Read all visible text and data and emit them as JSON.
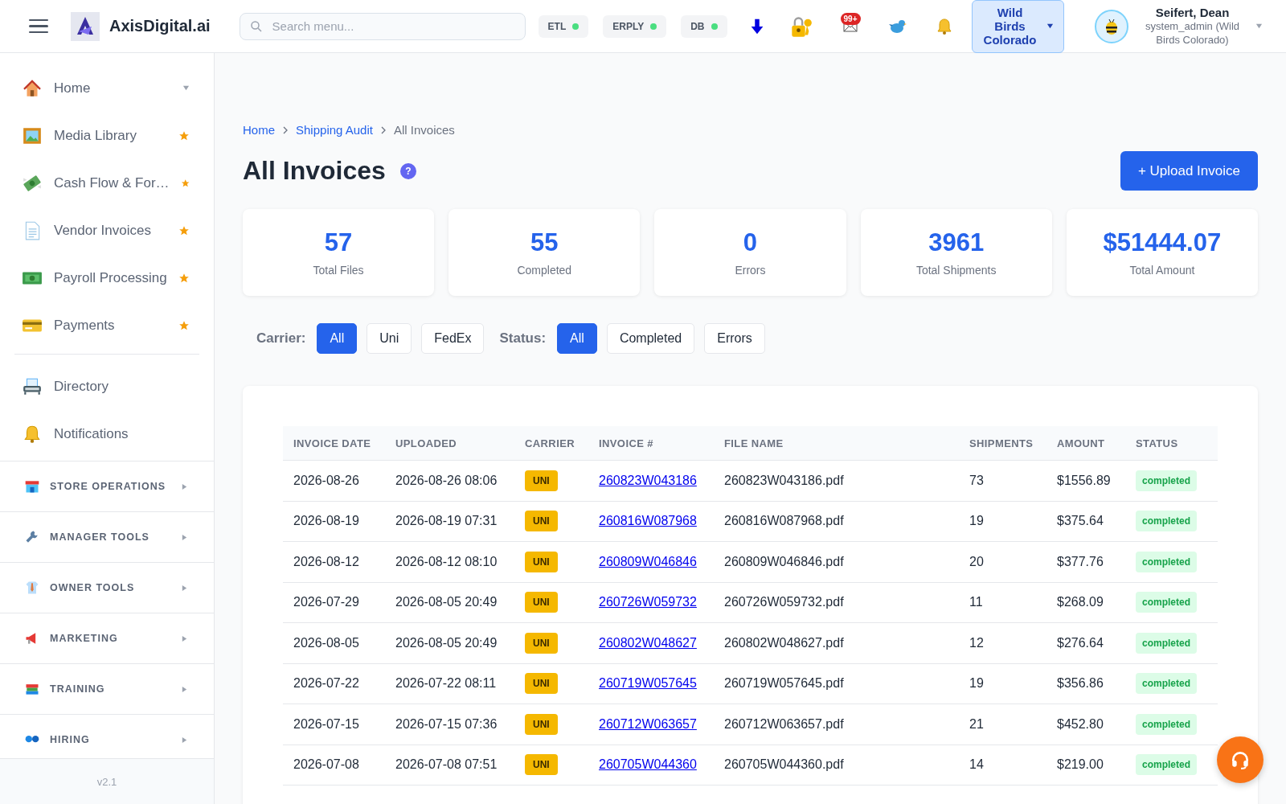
{
  "header": {
    "brand": "AxisDigital.ai",
    "search": {
      "placeholder": "Search menu..."
    },
    "statuses": [
      {
        "label": "ETL",
        "online": true
      },
      {
        "label": "ERPLY",
        "online": true
      },
      {
        "label": "DB",
        "online": true
      }
    ],
    "mail_badge": "99+",
    "organization": "Wild Birds Colorado",
    "user": {
      "name": "Seifert, Dean",
      "role": "system_admin (Wild Birds Colorado)"
    }
  },
  "sidebar": {
    "items": [
      {
        "label": "Home",
        "kind": "menu"
      },
      {
        "label": "Media Library",
        "kind": "link",
        "favorite": true
      },
      {
        "label": "Cash Flow & For…",
        "kind": "link",
        "favorite": true
      },
      {
        "label": "Vendor Invoices",
        "kind": "link",
        "favorite": true
      },
      {
        "label": "Payroll Processing",
        "kind": "link",
        "favorite": true
      },
      {
        "label": "Payments",
        "kind": "link",
        "favorite": true
      },
      {
        "label": "Directory",
        "kind": "link",
        "favorite": false
      },
      {
        "label": "Notifications",
        "kind": "link",
        "favorite": false
      }
    ],
    "sections": [
      {
        "label": "STORE OPERATIONS",
        "expanded": false
      },
      {
        "label": "MANAGER TOOLS",
        "expanded": false
      },
      {
        "label": "OWNER TOOLS",
        "expanded": false
      },
      {
        "label": "MARKETING",
        "expanded": false
      },
      {
        "label": "TRAINING",
        "expanded": false
      },
      {
        "label": "HIRING",
        "expanded": false
      }
    ],
    "version": "v2.1"
  },
  "breadcrumb": [
    {
      "label": "Home",
      "link": true
    },
    {
      "label": "Shipping Audit",
      "link": true
    },
    {
      "label": "All Invoices",
      "link": false
    }
  ],
  "title": "All Invoices",
  "help": "?",
  "upload_button": "+ Upload Invoice",
  "stats": [
    {
      "value": "57",
      "label": "Total Files"
    },
    {
      "value": "55",
      "label": "Completed"
    },
    {
      "value": "0",
      "label": "Errors"
    },
    {
      "value": "3961",
      "label": "Total Shipments"
    },
    {
      "value": "$51444.07",
      "label": "Total Amount"
    }
  ],
  "filters": [
    {
      "label": "Carrier:",
      "options": [
        {
          "label": "All",
          "selected": true
        },
        {
          "label": "Uni",
          "selected": false
        },
        {
          "label": "FedEx",
          "selected": false
        }
      ]
    },
    {
      "label": "Status:",
      "options": [
        {
          "label": "All",
          "selected": true
        },
        {
          "label": "Completed",
          "selected": false
        },
        {
          "label": "Errors",
          "selected": false
        }
      ]
    }
  ],
  "table": {
    "columns": [
      "INVOICE DATE",
      "UPLOADED",
      "CARRIER",
      "INVOICE #",
      "FILE NAME",
      "SHIPMENTS",
      "AMOUNT",
      "STATUS"
    ],
    "rows": [
      [
        "2026-08-26",
        "2026-08-26 08:06",
        "UNI",
        "260823W043186",
        "260823W043186.pdf",
        "73",
        "$1556.89",
        "completed"
      ],
      [
        "2026-08-19",
        "2026-08-19 07:31",
        "UNI",
        "260816W087968",
        "260816W087968.pdf",
        "19",
        "$375.64",
        "completed"
      ],
      [
        "2026-08-12",
        "2026-08-12 08:10",
        "UNI",
        "260809W046846",
        "260809W046846.pdf",
        "20",
        "$377.76",
        "completed"
      ],
      [
        "2026-07-29",
        "2026-08-05 20:49",
        "UNI",
        "260726W059732",
        "260726W059732.pdf",
        "11",
        "$268.09",
        "completed"
      ],
      [
        "2026-08-05",
        "2026-08-05 20:49",
        "UNI",
        "260802W048627",
        "260802W048627.pdf",
        "12",
        "$276.64",
        "completed"
      ],
      [
        "2026-07-22",
        "2026-07-22 08:11",
        "UNI",
        "260719W057645",
        "260719W057645.pdf",
        "19",
        "$356.86",
        "completed"
      ],
      [
        "2026-07-15",
        "2026-07-15 07:36",
        "UNI",
        "260712W063657",
        "260712W063657.pdf",
        "21",
        "$452.80",
        "completed"
      ],
      [
        "2026-07-08",
        "2026-07-08 07:51",
        "UNI",
        "260705W044360",
        "260705W044360.pdf",
        "14",
        "$219.00",
        "completed"
      ]
    ]
  }
}
